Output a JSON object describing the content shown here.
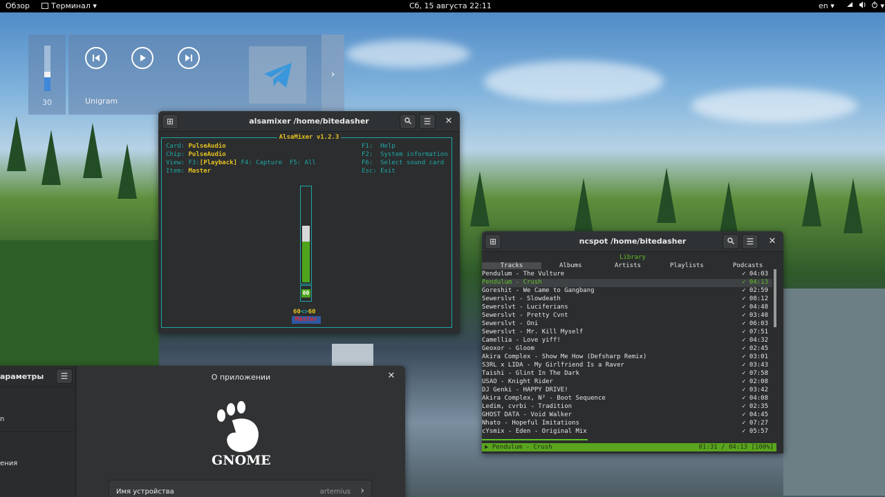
{
  "topbar": {
    "overview": "Обзор",
    "app_menu": "Терминал ▾",
    "clock": "Сб, 15 августа  22:11",
    "keyboard_layout": "en ▾",
    "system_menu_arrow": "▾"
  },
  "osd": {
    "volume_value": "30",
    "volume_level": 0.3,
    "media_app": "Unigram"
  },
  "alsamixer": {
    "window_title": "alsamixer /home/bitedasher",
    "frame_title": "AlsaMixer v1.2.3",
    "card_label": "Card: ",
    "card_value": "PulseAudio",
    "chip_label": "Chip: ",
    "chip_value": "PulseAudio",
    "view_label": "View: F3:",
    "view_active": "[Playback]",
    "view_rest": " F4: Capture  F5: All",
    "item_label": "Item: ",
    "item_value": "Master",
    "help_f1": "F1:  Help",
    "help_f2": "F2:  System information",
    "help_f6": "F6:  Select sound card",
    "help_esc": "Esc: Exit",
    "fader_value": "00",
    "level_percent": 60,
    "vol_left": "60",
    "vol_sep": "<>",
    "vol_right": "60",
    "control": "Master"
  },
  "ncspot": {
    "window_title": "ncspot /home/bitedasher",
    "library_title": "Library",
    "tabs": [
      "Tracks",
      "Albums",
      "Artists",
      "Playlists",
      "Podcasts"
    ],
    "tracks": [
      {
        "title": "Pendulum - The Vulture",
        "duration": "✓ 04:03"
      },
      {
        "title": "Pendulum - Crush",
        "duration": "✓ 04:13"
      },
      {
        "title": "Goreshit - We Came to Gangbang",
        "duration": "✓ 02:59"
      },
      {
        "title": "Sewerslvt - Slowdeath",
        "duration": "✓ 08:12"
      },
      {
        "title": "Sewerslvt - Luciferians",
        "duration": "✓ 04:48"
      },
      {
        "title": "Sewerslvt - Pretty Cvnt",
        "duration": "✓ 03:40"
      },
      {
        "title": "Sewerslvt - Oni",
        "duration": "✓ 06:03"
      },
      {
        "title": "Sewerslvt - Mr. Kill Myself",
        "duration": "✓ 07:51"
      },
      {
        "title": "Camellia - Love yiff!",
        "duration": "✓ 04:32"
      },
      {
        "title": "Geoxor - Gloom",
        "duration": "✓ 02:45"
      },
      {
        "title": "Akira Complex - Show Me How (Defsharp Remix)",
        "duration": "✓ 03:01"
      },
      {
        "title": "S3RL x LIDA - My Girlfriend Is a Raver",
        "duration": "✓ 03:43"
      },
      {
        "title": "Taishi - Glint In The Dark",
        "duration": "✓ 07:58"
      },
      {
        "title": "USAO - Knight Rider",
        "duration": "✓ 02:08"
      },
      {
        "title": "DJ Genki - HAPPY DRIVE!",
        "duration": "✓ 03:42"
      },
      {
        "title": "Akira Complex, N² - Boot Sequence",
        "duration": "✓ 04:08"
      },
      {
        "title": "Ledim, cvrbi - Tradition",
        "duration": "✓ 02:35"
      },
      {
        "title": "GHOST DATA - Void Walker",
        "duration": "✓ 04:45"
      },
      {
        "title": "Nhato - Hopeful Imitations",
        "duration": "✓ 07:27"
      },
      {
        "title": "cYsmix - Eden - Original Mix",
        "duration": "✓ 05:57"
      }
    ],
    "playing_index": 1,
    "status_track": "▶  Pendulum - Crush",
    "status_time": "01:31 / 04:13 [100%]",
    "progress": 0.36
  },
  "settings": {
    "sidebar_title": "араметры",
    "sidebar_item_1": "n",
    "sidebar_item_2": "ения",
    "main_title": "О приложении",
    "logo_text": "GNOME",
    "device_label": "Имя устройства",
    "device_value": "artemius"
  }
}
